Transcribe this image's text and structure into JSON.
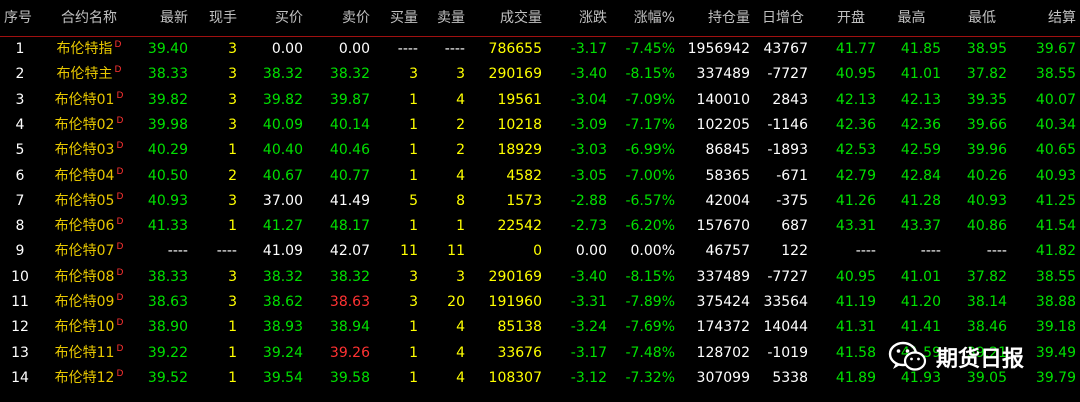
{
  "columns": [
    "序号",
    "合约名称",
    "最新",
    "现手",
    "买价",
    "卖价",
    "买量",
    "卖量",
    "成交量",
    "涨跌",
    "涨幅%",
    "持仓量",
    "日增仓",
    "开盘",
    "最高",
    "最低",
    "结算"
  ],
  "rows": [
    {
      "seq": "1",
      "name": "布伦特指",
      "last": "39.40",
      "vol_hand": "3",
      "bid": "0.00",
      "ask": "0.00",
      "bid_qty": "----",
      "ask_qty": "----",
      "volume": "786655",
      "chg": "-3.17",
      "pct": "-7.45%",
      "oi": "1956942",
      "oi_chg": "43767",
      "open": "41.77",
      "high": "41.85",
      "low": "38.95",
      "settle": "39.67"
    },
    {
      "seq": "2",
      "name": "布伦特主",
      "last": "38.33",
      "vol_hand": "3",
      "bid": "38.32",
      "ask": "38.32",
      "bid_qty": "3",
      "ask_qty": "3",
      "volume": "290169",
      "chg": "-3.40",
      "pct": "-8.15%",
      "oi": "337489",
      "oi_chg": "-7727",
      "open": "40.95",
      "high": "41.01",
      "low": "37.82",
      "settle": "38.55"
    },
    {
      "seq": "3",
      "name": "布伦特01",
      "last": "39.82",
      "vol_hand": "3",
      "bid": "39.82",
      "ask": "39.87",
      "bid_qty": "1",
      "ask_qty": "4",
      "volume": "19561",
      "chg": "-3.04",
      "pct": "-7.09%",
      "oi": "140010",
      "oi_chg": "2843",
      "open": "42.13",
      "high": "42.13",
      "low": "39.35",
      "settle": "40.07"
    },
    {
      "seq": "4",
      "name": "布伦特02",
      "last": "39.98",
      "vol_hand": "3",
      "bid": "40.09",
      "ask": "40.14",
      "bid_qty": "1",
      "ask_qty": "2",
      "volume": "10218",
      "chg": "-3.09",
      "pct": "-7.17%",
      "oi": "102205",
      "oi_chg": "-1146",
      "open": "42.36",
      "high": "42.36",
      "low": "39.66",
      "settle": "40.34"
    },
    {
      "seq": "5",
      "name": "布伦特03",
      "last": "40.29",
      "vol_hand": "1",
      "bid": "40.40",
      "ask": "40.46",
      "bid_qty": "1",
      "ask_qty": "2",
      "volume": "18929",
      "chg": "-3.03",
      "pct": "-6.99%",
      "oi": "86845",
      "oi_chg": "-1893",
      "open": "42.53",
      "high": "42.59",
      "low": "39.96",
      "settle": "40.65"
    },
    {
      "seq": "6",
      "name": "布伦特04",
      "last": "40.50",
      "vol_hand": "2",
      "bid": "40.67",
      "ask": "40.77",
      "bid_qty": "1",
      "ask_qty": "4",
      "volume": "4582",
      "chg": "-3.05",
      "pct": "-7.00%",
      "oi": "58365",
      "oi_chg": "-671",
      "open": "42.79",
      "high": "42.84",
      "low": "40.26",
      "settle": "40.93"
    },
    {
      "seq": "7",
      "name": "布伦特05",
      "last": "40.93",
      "vol_hand": "3",
      "bid": "37.00",
      "ask": "41.49",
      "bid_qty": "5",
      "ask_qty": "8",
      "volume": "1573",
      "chg": "-2.88",
      "pct": "-6.57%",
      "oi": "42004",
      "oi_chg": "-375",
      "open": "41.26",
      "high": "41.28",
      "low": "40.93",
      "settle": "41.25"
    },
    {
      "seq": "8",
      "name": "布伦特06",
      "last": "41.33",
      "vol_hand": "1",
      "bid": "41.27",
      "ask": "48.17",
      "bid_qty": "1",
      "ask_qty": "1",
      "volume": "22542",
      "chg": "-2.73",
      "pct": "-6.20%",
      "oi": "157670",
      "oi_chg": "687",
      "open": "43.31",
      "high": "43.37",
      "low": "40.86",
      "settle": "41.54"
    },
    {
      "seq": "9",
      "name": "布伦特07",
      "last": "----",
      "vol_hand": "----",
      "bid": "41.09",
      "ask": "42.07",
      "bid_qty": "11",
      "ask_qty": "11",
      "volume": "0",
      "chg": "0.00",
      "pct": "0.00%",
      "oi": "46757",
      "oi_chg": "122",
      "open": "----",
      "high": "----",
      "low": "----",
      "settle": "41.82"
    },
    {
      "seq": "10",
      "name": "布伦特08",
      "last": "38.33",
      "vol_hand": "3",
      "bid": "38.32",
      "ask": "38.32",
      "bid_qty": "3",
      "ask_qty": "3",
      "volume": "290169",
      "chg": "-3.40",
      "pct": "-8.15%",
      "oi": "337489",
      "oi_chg": "-7727",
      "open": "40.95",
      "high": "41.01",
      "low": "37.82",
      "settle": "38.55"
    },
    {
      "seq": "11",
      "name": "布伦特09",
      "last": "38.63",
      "vol_hand": "3",
      "bid": "38.62",
      "ask": "38.63",
      "bid_qty": "3",
      "ask_qty": "20",
      "volume": "191960",
      "chg": "-3.31",
      "pct": "-7.89%",
      "oi": "375424",
      "oi_chg": "33564",
      "open": "41.19",
      "high": "41.20",
      "low": "38.14",
      "settle": "38.88"
    },
    {
      "seq": "12",
      "name": "布伦特10",
      "last": "38.90",
      "vol_hand": "1",
      "bid": "38.93",
      "ask": "38.94",
      "bid_qty": "1",
      "ask_qty": "4",
      "volume": "85138",
      "chg": "-3.24",
      "pct": "-7.69%",
      "oi": "174372",
      "oi_chg": "14044",
      "open": "41.31",
      "high": "41.41",
      "low": "38.46",
      "settle": "39.18"
    },
    {
      "seq": "13",
      "name": "布伦特11",
      "last": "39.22",
      "vol_hand": "1",
      "bid": "39.24",
      "ask": "39.26",
      "bid_qty": "1",
      "ask_qty": "4",
      "volume": "33676",
      "chg": "-3.17",
      "pct": "-7.48%",
      "oi": "128702",
      "oi_chg": "-1019",
      "open": "41.58",
      "high": "41.59",
      "low": "39.21",
      "settle": "39.49"
    },
    {
      "seq": "14",
      "name": "布伦特12",
      "last": "39.52",
      "vol_hand": "1",
      "bid": "39.54",
      "ask": "39.58",
      "bid_qty": "1",
      "ask_qty": "4",
      "volume": "108307",
      "chg": "-3.12",
      "pct": "-7.32%",
      "oi": "307099",
      "oi_chg": "5338",
      "open": "41.89",
      "high": "41.93",
      "low": "39.05",
      "settle": "39.79"
    }
  ],
  "name_suffix": "D",
  "ask_red_rows": [
    10,
    12
  ],
  "watermark": {
    "text": "期货日报",
    "icon": "wechat-icon"
  },
  "colors": {
    "up": "#ff3232",
    "down": "#00e000",
    "neutral": "#ffffff",
    "volume": "#ffff00",
    "name": "#e8c800",
    "header_line": "#a01010"
  }
}
